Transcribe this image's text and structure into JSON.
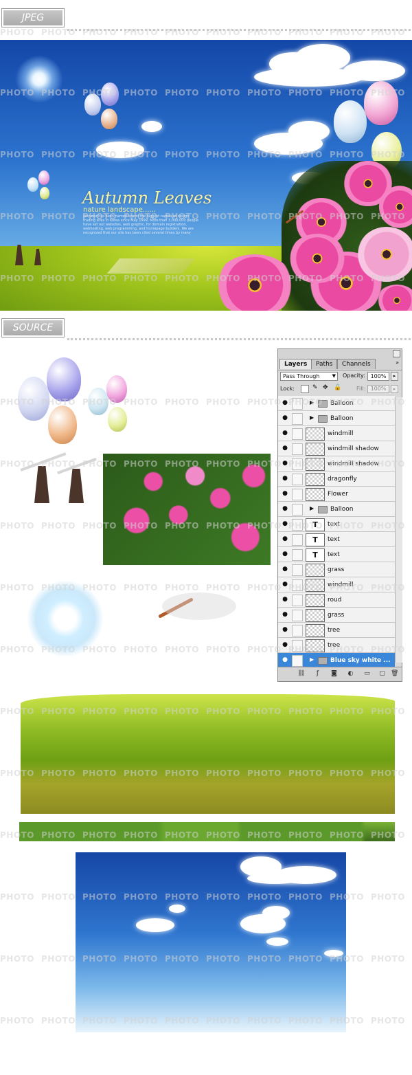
{
  "labels": {
    "jpeg": "JPEG",
    "source": "SOURCE"
  },
  "watermark": "PHOTO",
  "hero": {
    "title": "Autumn Leaves",
    "subtitle": "nature landscape......",
    "body": "Jeepster has been named one of the biggest names at design trading sites in Korea since May 1999. More than 3,000,000 people have set out websites, web graphic, for domain registration, webhosting, web programming, and homepage builders. We are recognized that our site has been cited several times by many news papers, magazines, and books all over the world."
  },
  "layers_panel": {
    "tabs": [
      "Layers",
      "Paths",
      "Channels"
    ],
    "blend_mode": "Pass Through",
    "opacity_label": "Opacity:",
    "opacity_value": "100%",
    "lock_label": "Lock:",
    "fill_label": "Fill:",
    "fill_value": "100%",
    "layers": [
      {
        "name": "Balloon",
        "kind": "group"
      },
      {
        "name": "Balloon",
        "kind": "group"
      },
      {
        "name": "windmill",
        "kind": "pixel"
      },
      {
        "name": "windmill  shadow",
        "kind": "pixel"
      },
      {
        "name": "windmill  shadow",
        "kind": "pixel"
      },
      {
        "name": "dragonfly",
        "kind": "pixel"
      },
      {
        "name": "Flower",
        "kind": "pixel"
      },
      {
        "name": "Balloon",
        "kind": "group"
      },
      {
        "name": "text",
        "kind": "text"
      },
      {
        "name": "text",
        "kind": "text"
      },
      {
        "name": "text",
        "kind": "text"
      },
      {
        "name": "grass",
        "kind": "pixel"
      },
      {
        "name": "windmill",
        "kind": "pixel"
      },
      {
        "name": "roud",
        "kind": "pixel"
      },
      {
        "name": "grass",
        "kind": "pixel"
      },
      {
        "name": "tree",
        "kind": "pixel"
      },
      {
        "name": "tree",
        "kind": "pixel"
      },
      {
        "name": "Blue sky white ...",
        "kind": "group",
        "selected": true
      }
    ]
  },
  "colors": {
    "sky": "#1f5fbf",
    "grass": "#a9c926",
    "flower": "#e0338f",
    "selection": "#3a86d8"
  }
}
